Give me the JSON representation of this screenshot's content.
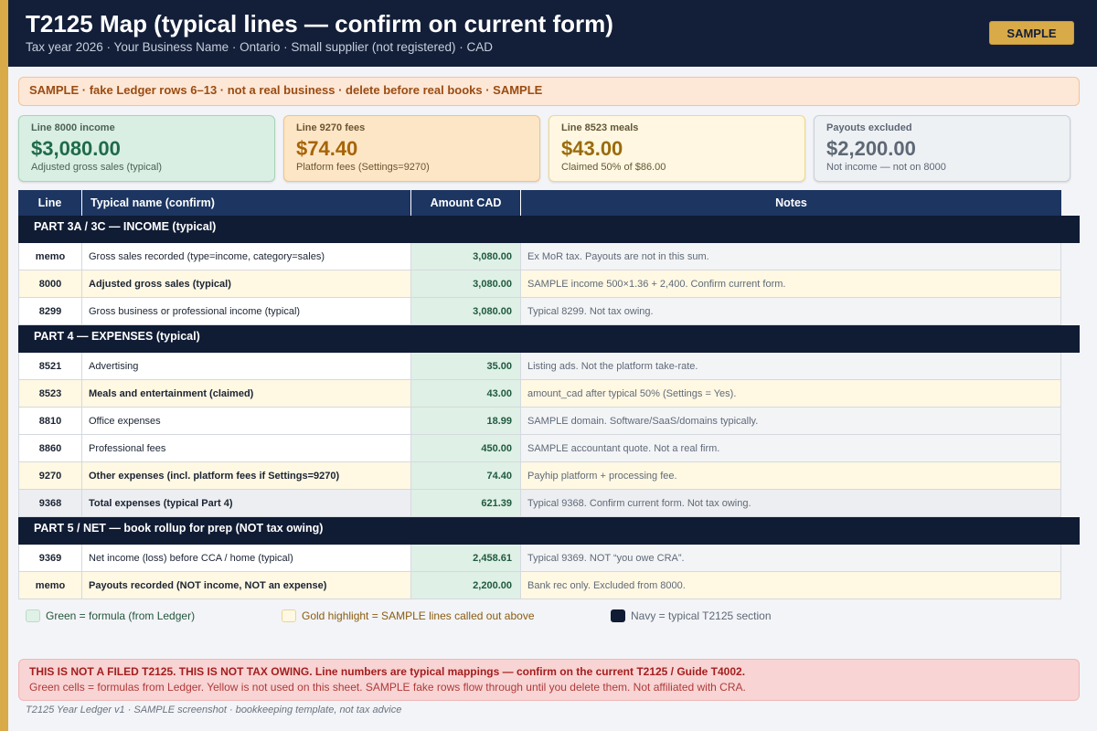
{
  "header": {
    "title": "T2125 Map (typical lines — confirm on current form)",
    "subtitle": "Tax year 2026  ·  Your Business Name  ·  Ontario  ·  Small supplier (not registered)  ·  CAD",
    "badge": "SAMPLE"
  },
  "banner": "SAMPLE  ·  fake Ledger rows 6–13  ·  not a real business  ·  delete before real books  ·  SAMPLE",
  "cards": {
    "income": {
      "label": "Line 8000  income",
      "value": "$3,080.00",
      "desc": "Adjusted gross sales (typical)"
    },
    "fees": {
      "label": "Line 9270  fees",
      "value": "$74.40",
      "desc": "Platform fees (Settings=9270)"
    },
    "meals": {
      "label": "Line 8523  meals",
      "value": "$43.00",
      "desc": "Claimed 50% of $86.00"
    },
    "payouts": {
      "label": "Payouts  excluded",
      "value": "$2,200.00",
      "desc": "Not income — not on 8000"
    }
  },
  "table": {
    "headers": {
      "line": "Line",
      "name": "Typical name (confirm)",
      "amount": "Amount CAD",
      "notes": "Notes"
    },
    "sections": [
      "PART 3A / 3C  —  INCOME  (typical)",
      "PART 4  —  EXPENSES  (typical)",
      "PART 5 / NET  —  book rollup for prep  (NOT tax owing)"
    ],
    "rows": [
      {
        "line": "memo",
        "name": "Gross sales recorded (type=income, category=sales)",
        "amount": "3,080.00",
        "notes": "Ex MoR tax. Payouts are not in this sum."
      },
      {
        "line": "8000",
        "name": "Adjusted gross sales (typical)",
        "amount": "3,080.00",
        "notes": "SAMPLE income 500×1.36 + 2,400. Confirm current form."
      },
      {
        "line": "8299",
        "name": "Gross business or professional income (typical)",
        "amount": "3,080.00",
        "notes": "Typical 8299. Not tax owing."
      },
      {
        "line": "8521",
        "name": "Advertising",
        "amount": "35.00",
        "notes": "Listing ads. Not the platform take-rate."
      },
      {
        "line": "8523",
        "name": "Meals and entertainment (claimed)",
        "amount": "43.00",
        "notes": "amount_cad after typical 50% (Settings = Yes)."
      },
      {
        "line": "8810",
        "name": "Office expenses",
        "amount": "18.99",
        "notes": "SAMPLE domain. Software/SaaS/domains typically."
      },
      {
        "line": "8860",
        "name": "Professional fees",
        "amount": "450.00",
        "notes": "SAMPLE accountant quote. Not a real firm."
      },
      {
        "line": "9270",
        "name": "Other expenses (incl. platform fees if Settings=9270)",
        "amount": "74.40",
        "notes": "Payhip platform + processing fee."
      },
      {
        "line": "9368",
        "name": "Total expenses (typical Part 4)",
        "amount": "621.39",
        "notes": "Typical 9368. Confirm current form. Not tax owing."
      },
      {
        "line": "9369",
        "name": "Net income (loss) before CCA / home (typical)",
        "amount": "2,458.61",
        "notes": "Typical 9369. NOT “you owe CRA”."
      },
      {
        "line": "memo",
        "name": "Payouts recorded (NOT income, NOT an expense)",
        "amount": "2,200.00",
        "notes": "Bank rec only. Excluded from 8000."
      }
    ]
  },
  "legend": {
    "green": "Green = formula (from Ledger)",
    "gold": "Gold highlight = SAMPLE lines called out above",
    "navy": "Navy = typical T2125 section"
  },
  "disclaimer": {
    "line1": "THIS IS NOT A FILED T2125. THIS IS NOT TAX OWING. Line numbers are typical mappings — confirm on the current T2125 / Guide T4002.",
    "line2": "Green cells = formulas from Ledger. Yellow is not used on this sheet. SAMPLE fake rows flow through until you delete them. Not affiliated with CRA."
  },
  "footer": "T2125 Year Ledger v1  ·  SAMPLE screenshot  ·  bookkeeping template, not tax advice",
  "colors": {
    "navy": "#131f38",
    "gold": "#d9aa48",
    "formula_green": "#dff0e6",
    "highlight_yellow": "#fff8e3"
  }
}
